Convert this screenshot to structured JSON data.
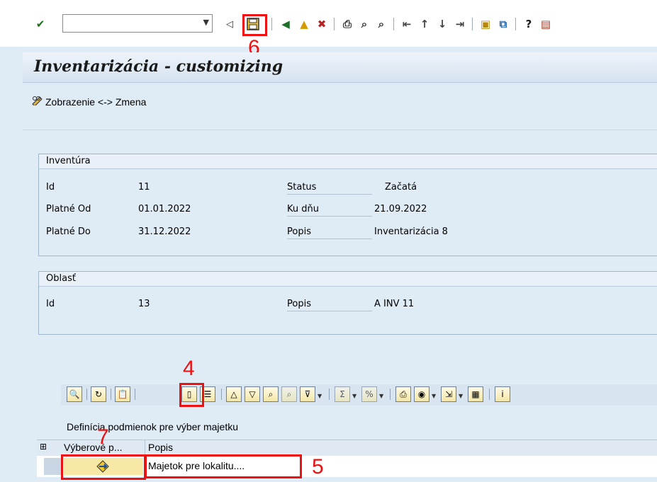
{
  "toolbar": {
    "command_value": "",
    "icons": {
      "enter": "checkmark-icon",
      "back_arrow": "triangle-left-icon",
      "save": "save-icon",
      "back": "back-icon",
      "exit": "exit-icon",
      "cancel": "cancel-icon",
      "print": "print-icon",
      "find": "find-icon",
      "find_next": "find-next-icon",
      "first_page": "first-page-icon",
      "prev_page": "prev-page-icon",
      "next_page": "next-page-icon",
      "last_page": "last-page-icon",
      "new_session": "new-session-icon",
      "shortcut": "shortcut-icon",
      "help": "help-icon",
      "layout": "layout-icon"
    }
  },
  "title": "Inventarizácia - customizing",
  "app_toolbar": {
    "toggle_label": "Zobrazenie <-> Zmena"
  },
  "inventura": {
    "header": "Inventúra",
    "id_label": "Id",
    "id_value": "11",
    "status_label": "Status",
    "status_value": "Začatá",
    "platne_od_label": "Platné Od",
    "platne_od_value": "01.01.2022",
    "ku_dnu_label": "Ku dňu",
    "ku_dnu_value": "21.09.2022",
    "platne_do_label": "Platné Do",
    "platne_do_value": "31.12.2022",
    "popis_label": "Popis",
    "popis_value": "Inventarizácia 8"
  },
  "oblast": {
    "header": "Oblasť",
    "id_label": "Id",
    "id_value": "13",
    "popis_label": "Popis",
    "popis_value": "A INV 11"
  },
  "alv": {
    "title": "Definícia podmienok pre výber majetku",
    "columns": [
      "Výberové p...",
      "Popis"
    ],
    "rows": [
      {
        "popis": "Majetok pre lokalitu...."
      }
    ]
  },
  "annotations": {
    "n4": "4",
    "n5": "5",
    "n6": "6",
    "n7": "7"
  },
  "colors": {
    "annotation": "#ee1111",
    "background": "#dfebf5"
  }
}
